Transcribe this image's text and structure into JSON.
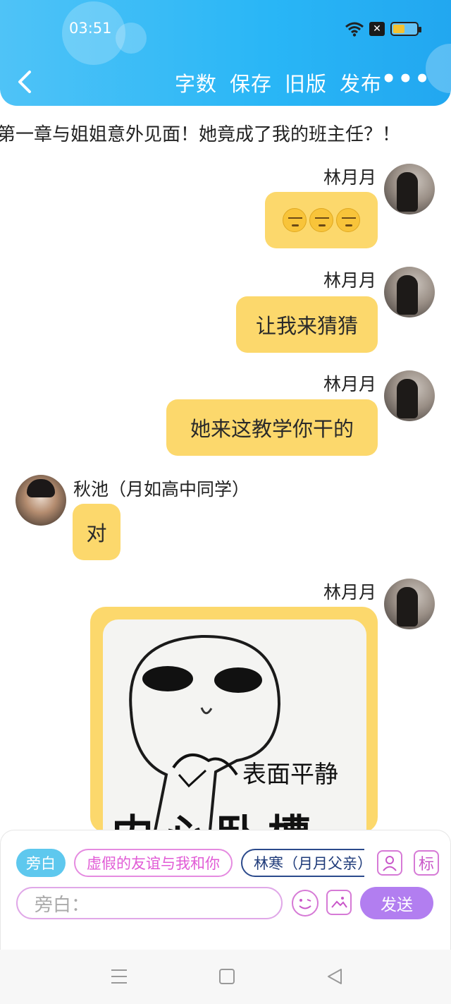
{
  "status_bar": {
    "time": "03:51"
  },
  "toolbar": {
    "word_count_label": "字数",
    "save_label": "保存",
    "old_version_label": "旧版",
    "publish_label": "发布",
    "more_label": "•••"
  },
  "chapter_title": "第一章与姐姐意外见面！她竟成了我的班主任？！",
  "messages": [
    {
      "sender": "林月月",
      "side": "right",
      "text": "😒😒😒"
    },
    {
      "sender": "林月月",
      "side": "right",
      "text": "让我来猜猜"
    },
    {
      "sender": "林月月",
      "side": "right",
      "text": "她来这教学你干的"
    },
    {
      "sender": "秋池（月如高中同学）",
      "side": "left",
      "text": "对"
    },
    {
      "sender": "林月月",
      "side": "right",
      "image_caption": "表面平静",
      "image_caption_2": "内心卧槽"
    }
  ],
  "composer": {
    "chips": [
      "旁白",
      "虚假的友谊与我和你",
      "林寒（月月父亲）"
    ],
    "tag_button_label": "标",
    "input_placeholder": "旁白：",
    "send_label": "发送"
  }
}
